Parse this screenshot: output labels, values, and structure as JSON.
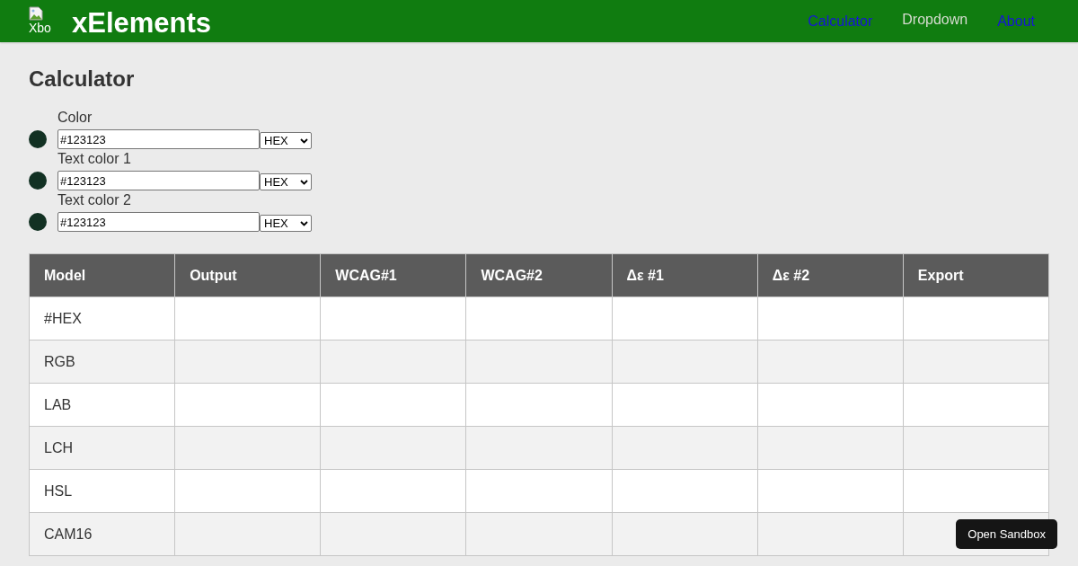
{
  "header": {
    "logo_alt": "Xbo",
    "title": "xElements",
    "nav": [
      {
        "label": "Calculator",
        "kind": "link"
      },
      {
        "label": "Dropdown",
        "kind": "dropdown"
      },
      {
        "label": "About",
        "kind": "link"
      }
    ]
  },
  "page_title": "Calculator",
  "color_inputs": [
    {
      "label": "Color",
      "value": "#123123",
      "format": "HEX",
      "color": "#123123"
    },
    {
      "label": "Text color 1",
      "value": "#123123",
      "format": "HEX",
      "color": "#123123"
    },
    {
      "label": "Text color 2",
      "value": "#123123",
      "format": "HEX",
      "color": "#123123"
    }
  ],
  "table": {
    "columns": [
      "Model",
      "Output",
      "WCAG#1",
      "WCAG#2",
      "Δε #1",
      "Δε #2",
      "Export"
    ],
    "rows": [
      {
        "model": "#HEX"
      },
      {
        "model": "RGB"
      },
      {
        "model": "LAB"
      },
      {
        "model": "LCH"
      },
      {
        "model": "HSL"
      },
      {
        "model": "CAM16"
      }
    ]
  },
  "sandbox_button": "Open Sandbox"
}
